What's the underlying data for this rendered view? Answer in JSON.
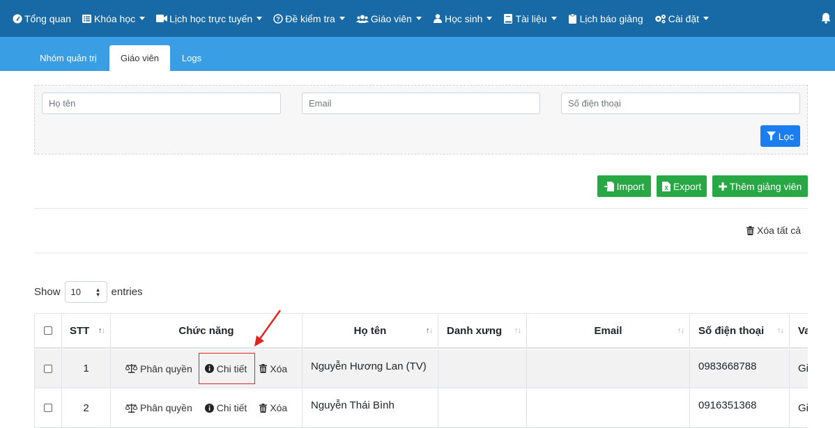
{
  "nav": {
    "items": [
      {
        "label": "Tổng quan",
        "icon": "dashboard-icon",
        "caret": false
      },
      {
        "label": "Khóa học",
        "icon": "list-icon",
        "caret": true
      },
      {
        "label": "Lịch học trực tuyến",
        "icon": "video-icon",
        "caret": true
      },
      {
        "label": "Đề kiểm tra",
        "icon": "question-circle-icon",
        "caret": true
      },
      {
        "label": "Giáo viên",
        "icon": "users-icon",
        "caret": true
      },
      {
        "label": "Học sinh",
        "icon": "user-icon",
        "caret": true
      },
      {
        "label": "Tài liệu",
        "icon": "book-icon",
        "caret": true
      },
      {
        "label": "Lịch báo giảng",
        "icon": "clipboard-icon",
        "caret": false
      },
      {
        "label": "Cài đặt",
        "icon": "gears-icon",
        "caret": true
      }
    ]
  },
  "tabs": [
    {
      "label": "Nhóm quản trị",
      "active": false
    },
    {
      "label": "Giáo viên",
      "active": true
    },
    {
      "label": "Logs",
      "active": false
    }
  ],
  "filter": {
    "name_placeholder": "Họ tên",
    "email_placeholder": "Email",
    "phone_placeholder": "Số điện thoại",
    "filter_label": "Lọc"
  },
  "actions": {
    "import_label": "Import",
    "export_label": "Export",
    "add_label": "Thêm giảng viên",
    "delete_all_label": "Xóa tất cả"
  },
  "length": {
    "show_label": "Show",
    "value": "10",
    "entries_label": "entries"
  },
  "table": {
    "columns": [
      "STT",
      "Chức năng",
      "Họ tên",
      "Danh xưng",
      "Email",
      "Số điện thoại",
      "Va"
    ],
    "row_actions": {
      "permission": "Phân quyền",
      "detail": "Chi tiết",
      "delete": "Xóa"
    },
    "rows": [
      {
        "stt": "1",
        "name": "Nguyễn Hương Lan (TV)",
        "title": "",
        "email": "",
        "phone": "0983668788",
        "extra": "Gi"
      },
      {
        "stt": "2",
        "name": "Nguyễn Thái Bình",
        "title": "",
        "email": "",
        "phone": "0916351368",
        "extra": "Gi"
      }
    ]
  },
  "colors": {
    "nav_bg": "#176aa5",
    "subnav_bg": "#3a9ee4",
    "primary": "#1a7df0",
    "success": "#28a745",
    "highlight": "#e02424"
  }
}
